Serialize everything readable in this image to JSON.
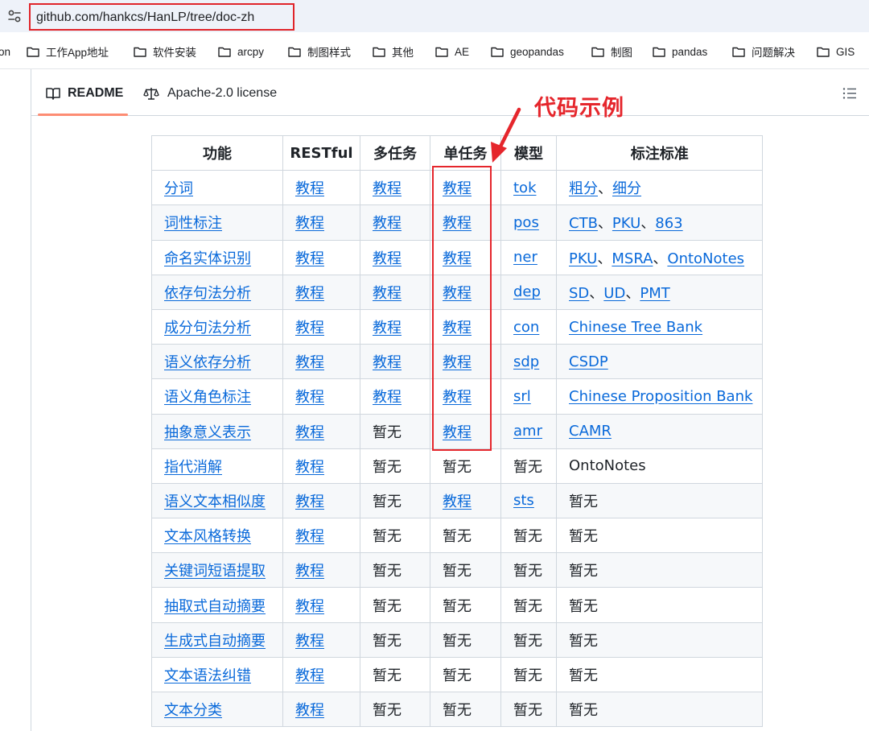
{
  "browser": {
    "url": "github.com/hankcs/HanLP/tree/doc-zh",
    "bookmarks": [
      {
        "label": "on",
        "folder": false
      },
      {
        "label": "工作App地址",
        "folder": true
      },
      {
        "label": "软件安装",
        "folder": true
      },
      {
        "label": "arcpy",
        "folder": true
      },
      {
        "label": "制图样式",
        "folder": true
      },
      {
        "label": "其他",
        "folder": true
      },
      {
        "label": "AE",
        "folder": true
      },
      {
        "label": "geopandas",
        "folder": true
      },
      {
        "label": "制图",
        "folder": true
      },
      {
        "label": "pandas",
        "folder": true
      },
      {
        "label": "问题解决",
        "folder": true
      },
      {
        "label": "GIS",
        "folder": true
      }
    ]
  },
  "tabs": {
    "readme": "README",
    "license": "Apache-2.0 license"
  },
  "annotation": {
    "label": "代码示例",
    "color": "#e5262c"
  },
  "table": {
    "headers": [
      "功能",
      "RESTful",
      "多任务",
      "单任务",
      "模型",
      "标注标准"
    ],
    "rows": [
      [
        {
          "t": "分词",
          "l": true
        },
        {
          "t": "教程",
          "l": true
        },
        {
          "t": "教程",
          "l": true
        },
        {
          "t": "教程",
          "l": true
        },
        {
          "t": "tok",
          "l": true
        },
        {
          "p": [
            {
              "t": "粗分",
              "l": true
            },
            {
              "t": "、",
              "l": false
            },
            {
              "t": "细分",
              "l": true
            }
          ]
        }
      ],
      [
        {
          "t": "词性标注",
          "l": true
        },
        {
          "t": "教程",
          "l": true
        },
        {
          "t": "教程",
          "l": true
        },
        {
          "t": "教程",
          "l": true
        },
        {
          "t": "pos",
          "l": true
        },
        {
          "p": [
            {
              "t": "CTB",
              "l": true
            },
            {
              "t": "、",
              "l": false
            },
            {
              "t": "PKU",
              "l": true
            },
            {
              "t": "、",
              "l": false
            },
            {
              "t": "863",
              "l": true
            }
          ]
        }
      ],
      [
        {
          "t": "命名实体识别",
          "l": true
        },
        {
          "t": "教程",
          "l": true
        },
        {
          "t": "教程",
          "l": true
        },
        {
          "t": "教程",
          "l": true
        },
        {
          "t": "ner",
          "l": true
        },
        {
          "p": [
            {
              "t": "PKU",
              "l": true
            },
            {
              "t": "、",
              "l": false
            },
            {
              "t": "MSRA",
              "l": true
            },
            {
              "t": "、",
              "l": false
            },
            {
              "t": "OntoNotes",
              "l": true
            }
          ]
        }
      ],
      [
        {
          "t": "依存句法分析",
          "l": true
        },
        {
          "t": "教程",
          "l": true
        },
        {
          "t": "教程",
          "l": true
        },
        {
          "t": "教程",
          "l": true
        },
        {
          "t": "dep",
          "l": true
        },
        {
          "p": [
            {
              "t": "SD",
              "l": true
            },
            {
              "t": "、",
              "l": false
            },
            {
              "t": "UD",
              "l": true
            },
            {
              "t": "、",
              "l": false
            },
            {
              "t": "PMT",
              "l": true
            }
          ]
        }
      ],
      [
        {
          "t": "成分句法分析",
          "l": true
        },
        {
          "t": "教程",
          "l": true
        },
        {
          "t": "教程",
          "l": true
        },
        {
          "t": "教程",
          "l": true
        },
        {
          "t": "con",
          "l": true
        },
        {
          "t": "Chinese Tree Bank",
          "l": true
        }
      ],
      [
        {
          "t": "语义依存分析",
          "l": true
        },
        {
          "t": "教程",
          "l": true
        },
        {
          "t": "教程",
          "l": true
        },
        {
          "t": "教程",
          "l": true
        },
        {
          "t": "sdp",
          "l": true
        },
        {
          "t": "CSDP",
          "l": true
        }
      ],
      [
        {
          "t": "语义角色标注",
          "l": true
        },
        {
          "t": "教程",
          "l": true
        },
        {
          "t": "教程",
          "l": true
        },
        {
          "t": "教程",
          "l": true
        },
        {
          "t": "srl",
          "l": true
        },
        {
          "t": "Chinese Proposition Bank",
          "l": true
        }
      ],
      [
        {
          "t": "抽象意义表示",
          "l": true
        },
        {
          "t": "教程",
          "l": true
        },
        {
          "t": "暂无",
          "l": false
        },
        {
          "t": "教程",
          "l": true
        },
        {
          "t": "amr",
          "l": true
        },
        {
          "t": "CAMR",
          "l": true
        }
      ],
      [
        {
          "t": "指代消解",
          "l": true
        },
        {
          "t": "教程",
          "l": true
        },
        {
          "t": "暂无",
          "l": false
        },
        {
          "t": "暂无",
          "l": false
        },
        {
          "t": "暂无",
          "l": false
        },
        {
          "t": "OntoNotes",
          "l": false
        }
      ],
      [
        {
          "t": "语义文本相似度",
          "l": true
        },
        {
          "t": "教程",
          "l": true
        },
        {
          "t": "暂无",
          "l": false
        },
        {
          "t": "教程",
          "l": true
        },
        {
          "t": "sts",
          "l": true
        },
        {
          "t": "暂无",
          "l": false
        }
      ],
      [
        {
          "t": "文本风格转换",
          "l": true
        },
        {
          "t": "教程",
          "l": true
        },
        {
          "t": "暂无",
          "l": false
        },
        {
          "t": "暂无",
          "l": false
        },
        {
          "t": "暂无",
          "l": false
        },
        {
          "t": "暂无",
          "l": false
        }
      ],
      [
        {
          "t": "关键词短语提取",
          "l": true
        },
        {
          "t": "教程",
          "l": true
        },
        {
          "t": "暂无",
          "l": false
        },
        {
          "t": "暂无",
          "l": false
        },
        {
          "t": "暂无",
          "l": false
        },
        {
          "t": "暂无",
          "l": false
        }
      ],
      [
        {
          "t": "抽取式自动摘要",
          "l": true
        },
        {
          "t": "教程",
          "l": true
        },
        {
          "t": "暂无",
          "l": false
        },
        {
          "t": "暂无",
          "l": false
        },
        {
          "t": "暂无",
          "l": false
        },
        {
          "t": "暂无",
          "l": false
        }
      ],
      [
        {
          "t": "生成式自动摘要",
          "l": true
        },
        {
          "t": "教程",
          "l": true
        },
        {
          "t": "暂无",
          "l": false
        },
        {
          "t": "暂无",
          "l": false
        },
        {
          "t": "暂无",
          "l": false
        },
        {
          "t": "暂无",
          "l": false
        }
      ],
      [
        {
          "t": "文本语法纠错",
          "l": true
        },
        {
          "t": "教程",
          "l": true
        },
        {
          "t": "暂无",
          "l": false
        },
        {
          "t": "暂无",
          "l": false
        },
        {
          "t": "暂无",
          "l": false
        },
        {
          "t": "暂无",
          "l": false
        }
      ],
      [
        {
          "t": "文本分类",
          "l": true
        },
        {
          "t": "教程",
          "l": true
        },
        {
          "t": "暂无",
          "l": false
        },
        {
          "t": "暂无",
          "l": false
        },
        {
          "t": "暂无",
          "l": false
        },
        {
          "t": "暂无",
          "l": false
        }
      ]
    ]
  }
}
